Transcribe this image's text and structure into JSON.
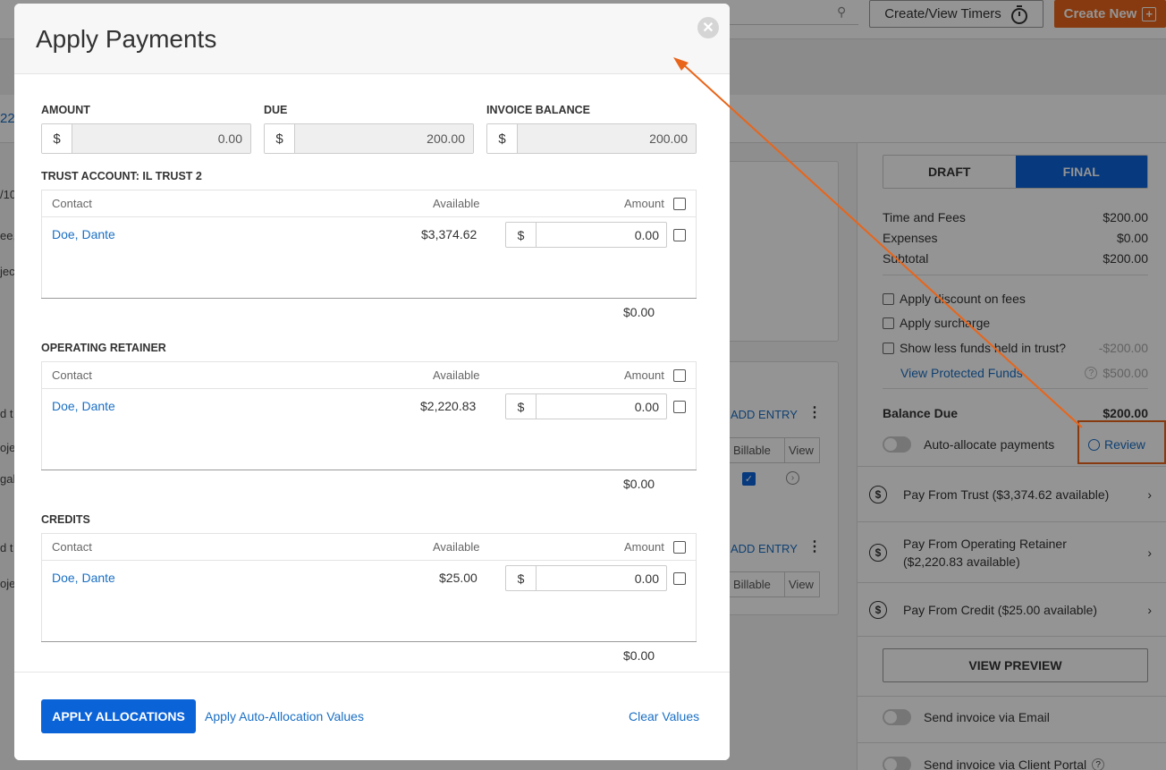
{
  "topbar": {
    "timers_label": "Create/View Timers",
    "create_label": "Create New"
  },
  "right_panel": {
    "tabs": [
      "DRAFT",
      "FINAL"
    ],
    "summary": [
      {
        "label": "Time and Fees",
        "value": "$200.00"
      },
      {
        "label": "Expenses",
        "value": "$0.00"
      },
      {
        "label": "Subtotal",
        "value": "$200.00"
      }
    ],
    "options": [
      {
        "label": "Apply discount on fees",
        "value": ""
      },
      {
        "label": "Apply surcharge",
        "value": ""
      },
      {
        "label": "Show less funds held in trust?",
        "value": "-$200.00"
      }
    ],
    "protected_funds_label": "View Protected Funds",
    "protected_funds_value": "$500.00",
    "balance_label": "Balance Due",
    "balance_value": "$200.00",
    "auto_allocate_label": "Auto-allocate payments",
    "review_label": "Review",
    "pay_options": [
      {
        "label": "Pay From Trust ($3,374.62 available)"
      },
      {
        "label": "Pay From Operating Retainer ($2,220.83 available)"
      },
      {
        "label": "Pay From Credit ($25.00 available)"
      }
    ],
    "preview_label": "VIEW PREVIEW",
    "send_email_label": "Send invoice via Email",
    "send_portal_label": "Send invoice via Client Portal"
  },
  "middle": {
    "add_entry_label": "ADD ENTRY",
    "billable_header": "Billable",
    "view_header": "View"
  },
  "left_fragments": {
    "f1": "22",
    "f2": "/10",
    "f3": "ee,",
    "f4": "jec",
    "f5": "d t",
    "f6": "oje",
    "f7": "gal"
  },
  "modal": {
    "title": "Apply Payments",
    "amount_label": "AMOUNT",
    "amount_value": "0.00",
    "due_label": "DUE",
    "due_value": "200.00",
    "invoice_balance_label": "INVOICE BALANCE",
    "invoice_balance_value": "200.00",
    "currency": "$",
    "col_contact": "Contact",
    "col_available": "Available",
    "col_amount": "Amount",
    "sections": [
      {
        "title": "TRUST ACCOUNT: IL TRUST 2",
        "contact": "Doe, Dante",
        "available": "$3,374.62",
        "amount": "0.00",
        "total": "$0.00"
      },
      {
        "title": "OPERATING RETAINER",
        "contact": "Doe, Dante",
        "available": "$2,220.83",
        "amount": "0.00",
        "total": "$0.00"
      },
      {
        "title": "CREDITS",
        "contact": "Doe, Dante",
        "available": "$25.00",
        "amount": "0.00",
        "total": "$0.00"
      }
    ],
    "apply_label": "APPLY ALLOCATIONS",
    "auto_alloc_label": "Apply Auto-Allocation Values",
    "clear_label": "Clear Values"
  },
  "colors": {
    "primary": "#0b63d8",
    "accent_orange": "#e8651a",
    "link": "#1a6fc4"
  }
}
